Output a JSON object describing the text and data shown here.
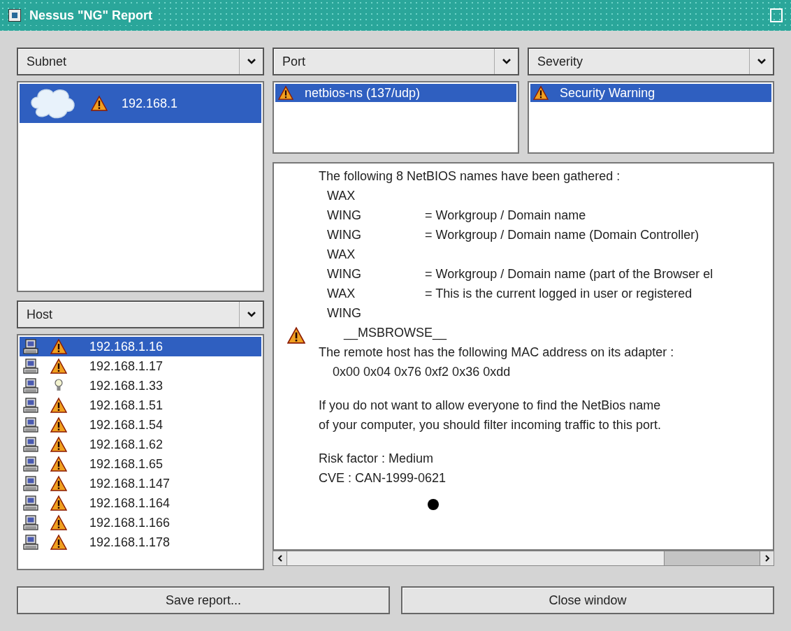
{
  "window": {
    "title": "Nessus \"NG\" Report"
  },
  "subnet": {
    "label": "Subnet",
    "items": [
      {
        "label": "192.168.1",
        "selected": true
      }
    ]
  },
  "port": {
    "label": "Port",
    "items": [
      {
        "label": "netbios-ns (137/udp)",
        "selected": true
      }
    ]
  },
  "severity": {
    "label": "Severity",
    "items": [
      {
        "label": "Security Warning",
        "selected": true
      }
    ]
  },
  "host": {
    "label": "Host",
    "items": [
      {
        "label": "192.168.1.16",
        "selected": true,
        "kind": "warning"
      },
      {
        "label": "192.168.1.17",
        "selected": false,
        "kind": "warning"
      },
      {
        "label": "192.168.1.33",
        "selected": false,
        "kind": "note"
      },
      {
        "label": "192.168.1.51",
        "selected": false,
        "kind": "warning"
      },
      {
        "label": "192.168.1.54",
        "selected": false,
        "kind": "warning"
      },
      {
        "label": "192.168.1.62",
        "selected": false,
        "kind": "warning"
      },
      {
        "label": "192.168.1.65",
        "selected": false,
        "kind": "warning"
      },
      {
        "label": "192.168.1.147",
        "selected": false,
        "kind": "warning"
      },
      {
        "label": "192.168.1.164",
        "selected": false,
        "kind": "warning"
      },
      {
        "label": "192.168.1.166",
        "selected": false,
        "kind": "warning"
      },
      {
        "label": "192.168.1.178",
        "selected": false,
        "kind": "warning"
      }
    ]
  },
  "report": {
    "intro": "The following 8 NetBIOS names have been gathered :",
    "names": [
      {
        "name": "WAX"
      },
      {
        "name": "WING",
        "description": "= Workgroup / Domain name"
      },
      {
        "name": "WING",
        "description": "= Workgroup / Domain name (Domain Controller)"
      },
      {
        "name": "WAX"
      },
      {
        "name": "WING",
        "description": "= Workgroup / Domain name (part of the Browser el"
      },
      {
        "name": "WAX",
        "description": "= This is the current logged in user or registered"
      },
      {
        "name": "WING"
      },
      {
        "name": "__MSBROWSE__"
      }
    ],
    "mac_intro": "The remote host has the following MAC address on its adapter :",
    "mac": "0x00 0x04 0x76 0xf2 0x36 0xdd",
    "advice": [
      "If you do not want to allow everyone to find the NetBios name",
      "of your computer, you should filter incoming traffic to this port."
    ],
    "risk": "Risk factor : Medium",
    "cve": "CVE : CAN-1999-0621"
  },
  "buttons": [
    {
      "label": "Save report..."
    },
    {
      "label": "Close window"
    }
  ]
}
